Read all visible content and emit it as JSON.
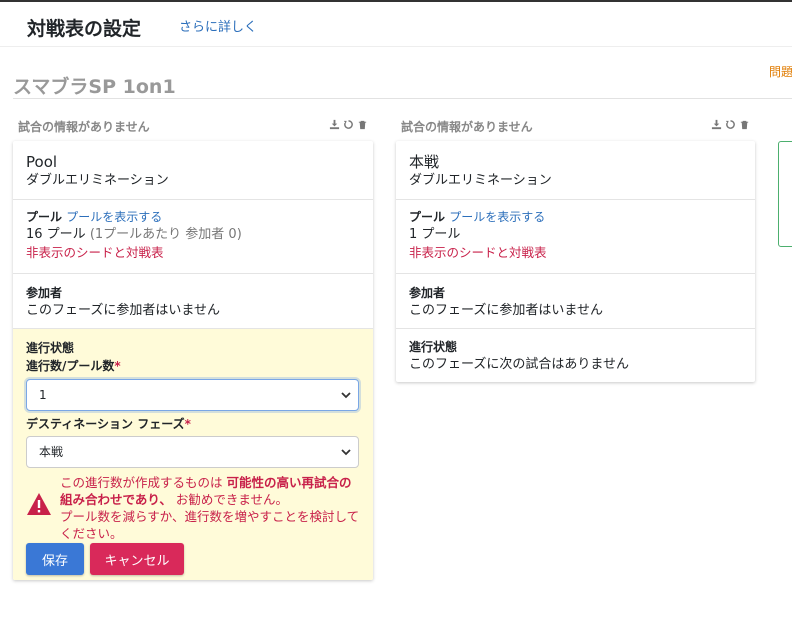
{
  "header": {
    "title": "対戦表の設定",
    "details_link": "さらに詳しく"
  },
  "tournament": {
    "name": "スマブラSP 1on1",
    "problem_link": "問題"
  },
  "icons": [
    "download-icon",
    "reset-icon",
    "trash-icon",
    "chevron-down-icon",
    "warning-icon"
  ],
  "colors": {
    "accent_blue": "#2c6fbb",
    "danger_red": "#c8214a",
    "save_button": "#3a78d6",
    "cancel_button": "#d9295a",
    "edit_background": "#fffbd9"
  },
  "phases": [
    {
      "header_text": "試合の情報がありません",
      "name": "Pool",
      "type": "ダブルエリミネーション",
      "pools_label": "プール",
      "pools_link": "プールを表示する",
      "pools_count": "16 プール",
      "pools_detail": "(1プールあたり 参加者 0)",
      "hidden_seeds_link": "非表示のシードと対戦表",
      "entrants_label": "参加者",
      "entrants_text": "このフェーズに参加者はいません",
      "progress": {
        "label": "進行状態",
        "count_label": "進行数/プール数",
        "required_mark": "*",
        "count_value": "1",
        "destination_label": "デスティネーション フェーズ",
        "destination_value": "本戦",
        "warning_line1_a": "この進行数が作成するものは",
        "warning_line1_b": "可能性の高い再試合の組み合わせであり、",
        "warning_line1_c": "お勧めできません。",
        "warning_line2": "プール数を減らすか、進行数を増やすことを検討してください。",
        "save_label": "保存",
        "cancel_label": "キャンセル"
      }
    },
    {
      "header_text": "試合の情報がありません",
      "name": "本戦",
      "type": "ダブルエリミネーション",
      "pools_label": "プール",
      "pools_link": "プールを表示する",
      "pools_count": "1 プール",
      "hidden_seeds_link": "非表示のシードと対戦表",
      "entrants_label": "参加者",
      "entrants_text": "このフェーズに参加者はいません",
      "progress_label": "進行状態",
      "progress_text": "このフェーズに次の試合はありません"
    }
  ]
}
